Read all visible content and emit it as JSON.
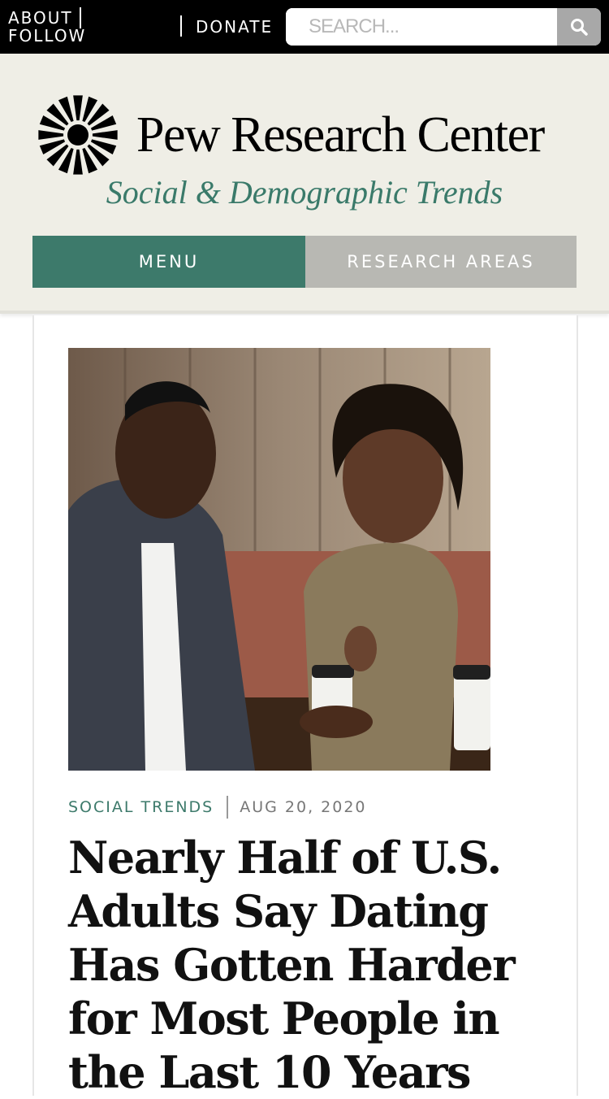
{
  "topbar": {
    "about": "ABOUT",
    "follow": "FOLLOW",
    "donate": "DONATE",
    "search_placeholder": "SEARCH...",
    "search_icon": "search-icon"
  },
  "header": {
    "logo_text": "Pew Research Center",
    "subtitle": "Social & Demographic Trends",
    "logo_icon": "sunburst-logo-icon"
  },
  "nav": {
    "menu": "MENU",
    "research_areas": "RESEARCH AREAS"
  },
  "colors": {
    "topbar": "#000000",
    "header_bg": "#efeee6",
    "accent_green": "#3d7a6b",
    "nav_gray": "#b8b8b3"
  },
  "article": {
    "topic": "SOCIAL TRENDS",
    "date": "AUG 20, 2020",
    "headline": "Nearly Half of U.S. Adults Say Dating Has Gotten Harder for Most People in the Last 10 Years"
  }
}
